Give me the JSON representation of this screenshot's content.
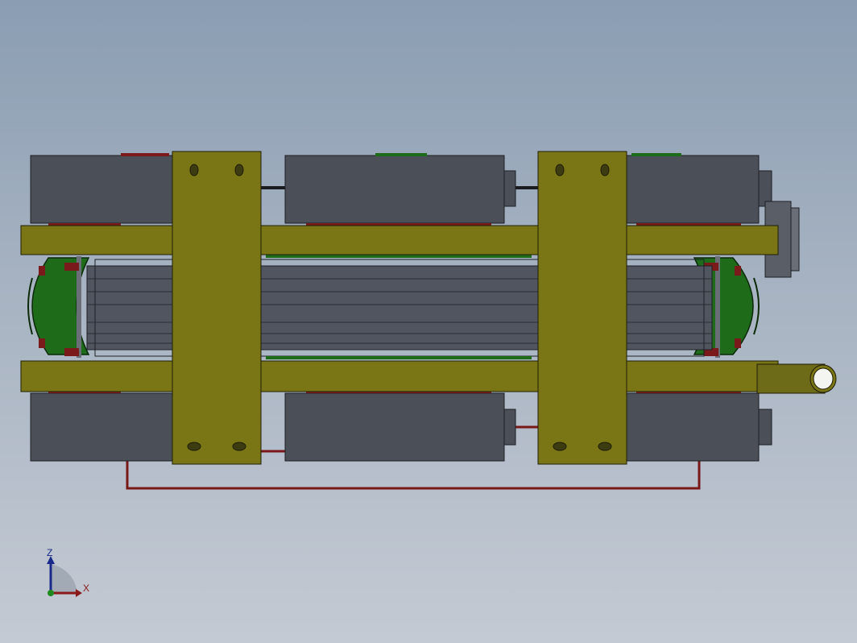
{
  "viewport": {
    "background_top": "#8a9db2",
    "background_bottom": "#c4cad3"
  },
  "colors": {
    "box_gray": "#4b4f57",
    "box_edge": "#1e2024",
    "plate_olive": "#7a7615",
    "plate_edge": "#1f1d05",
    "green_ring": "#1e6b1a",
    "red_accent": "#7a1a1a",
    "wire_red": "#7a1818",
    "core_gray": "#505560"
  },
  "triad": {
    "z_label": "Z",
    "x_label": "X",
    "z_color": "#1a2a8a",
    "x_color": "#8a1a1a"
  }
}
